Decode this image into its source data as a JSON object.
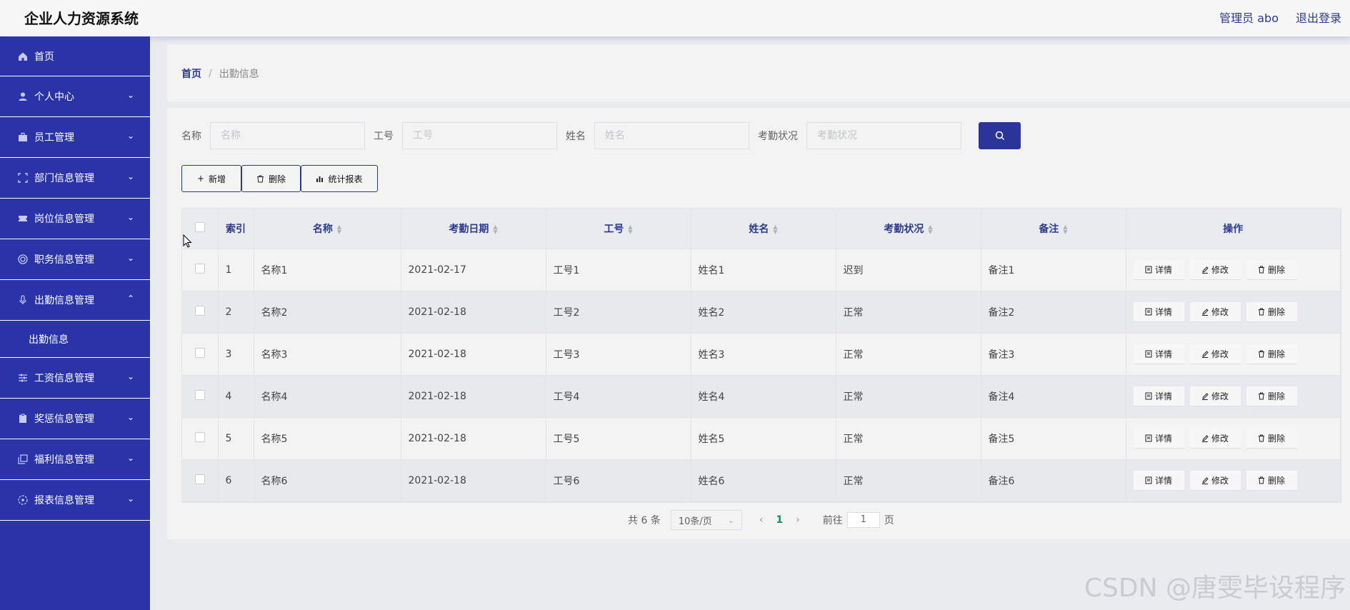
{
  "header": {
    "title": "企业人力资源系统",
    "user_label": "管理员 abo",
    "logout_label": "退出登录"
  },
  "sidebar": {
    "items": [
      {
        "label": "首页",
        "icon": "home-icon"
      },
      {
        "label": "个人中心",
        "icon": "user-icon"
      },
      {
        "label": "员工管理",
        "icon": "briefcase-icon"
      },
      {
        "label": "部门信息管理",
        "icon": "frame-icon"
      },
      {
        "label": "岗位信息管理",
        "icon": "ticket-icon"
      },
      {
        "label": "职务信息管理",
        "icon": "target-icon"
      },
      {
        "label": "出勤信息管理",
        "icon": "mic-icon"
      },
      {
        "label": "工资信息管理",
        "icon": "sliders-icon"
      },
      {
        "label": "奖惩信息管理",
        "icon": "clipboard-icon"
      },
      {
        "label": "福利信息管理",
        "icon": "copy-icon"
      },
      {
        "label": "报表信息管理",
        "icon": "compass-icon"
      }
    ],
    "submenu_label": "出勤信息"
  },
  "breadcrumb": {
    "home": "首页",
    "separator": "/",
    "current": "出勤信息"
  },
  "search": {
    "fields": [
      {
        "label": "名称",
        "placeholder": "名称"
      },
      {
        "label": "工号",
        "placeholder": "工号"
      },
      {
        "label": "姓名",
        "placeholder": "姓名"
      },
      {
        "label": "考勤状况",
        "placeholder": "考勤状况"
      }
    ]
  },
  "actions": {
    "add": "新增",
    "delete": "删除",
    "report": "统计报表"
  },
  "table": {
    "headers": {
      "index": "索引",
      "name": "名称",
      "date": "考勤日期",
      "job_no": "工号",
      "person": "姓名",
      "status": "考勤状况",
      "remark": "备注",
      "ops": "操作"
    },
    "rows": [
      {
        "index": "1",
        "name": "名称1",
        "date": "2021-02-17",
        "job_no": "工号1",
        "person": "姓名1",
        "status": "迟到",
        "remark": "备注1"
      },
      {
        "index": "2",
        "name": "名称2",
        "date": "2021-02-18",
        "job_no": "工号2",
        "person": "姓名2",
        "status": "正常",
        "remark": "备注2"
      },
      {
        "index": "3",
        "name": "名称3",
        "date": "2021-02-18",
        "job_no": "工号3",
        "person": "姓名3",
        "status": "正常",
        "remark": "备注3"
      },
      {
        "index": "4",
        "name": "名称4",
        "date": "2021-02-18",
        "job_no": "工号4",
        "person": "姓名4",
        "status": "正常",
        "remark": "备注4"
      },
      {
        "index": "5",
        "name": "名称5",
        "date": "2021-02-18",
        "job_no": "工号5",
        "person": "姓名5",
        "status": "正常",
        "remark": "备注5"
      },
      {
        "index": "6",
        "name": "名称6",
        "date": "2021-02-18",
        "job_no": "工号6",
        "person": "姓名6",
        "status": "正常",
        "remark": "备注6"
      }
    ],
    "row_ops": {
      "detail": "详情",
      "edit": "修改",
      "delete": "删除"
    }
  },
  "pagination": {
    "total": "共 6 条",
    "page_size": "10条/页",
    "current_page": "1",
    "goto_prefix": "前往",
    "goto_value": "1",
    "goto_suffix": "页"
  },
  "watermark": "CSDN @唐雯毕设程序",
  "colors": {
    "sidebar": "#2a33a8",
    "accent": "#2b3599",
    "page_active": "#1b8b6c"
  }
}
